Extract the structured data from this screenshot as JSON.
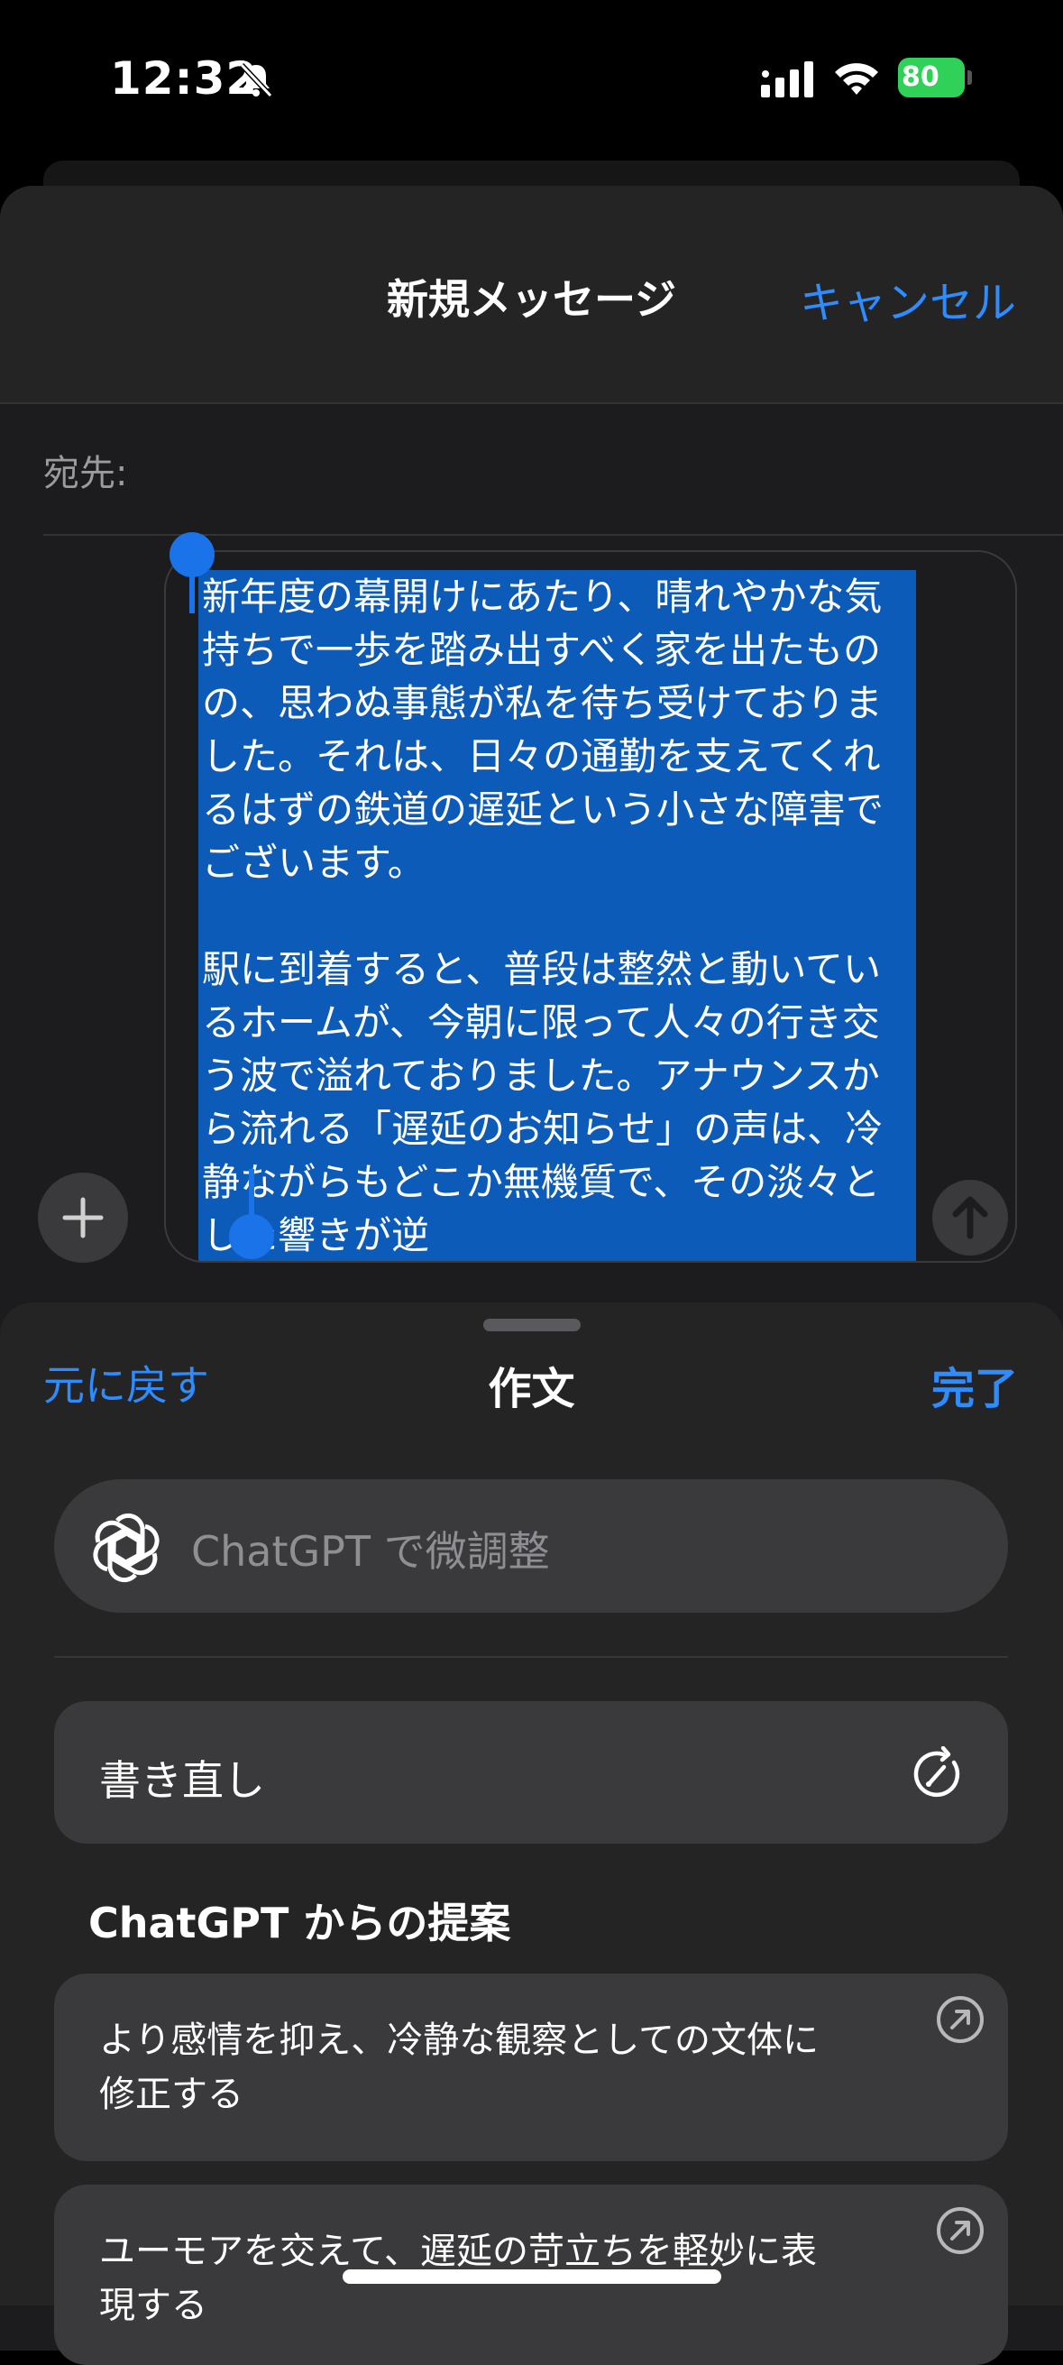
{
  "status_bar": {
    "time": "12:32",
    "battery": "80"
  },
  "header": {
    "title": "新規メッセージ",
    "cancel_label": "キャンセル"
  },
  "recipient": {
    "label": "宛先:"
  },
  "compose": {
    "text": "新年度の幕開けにあたり、晴れやかな気持ちで一歩を踏み出すべく家を出たものの、思わぬ事態が私を待ち受けておりました。それは、日々の通勤を支えてくれるはずの鉄道の遅延という小さな障害でございます。\n\n駅に到着すると、普段は整然と動いているホームが、今朝に限って人々の行き交う波で溢れておりました。アナウンスから流れる「遅延のお知らせ」の声は、冷静ながらもどこか無機質で、その淡々とした響きが逆"
  },
  "writing_tools": {
    "undo_label": "元に戻す",
    "title": "作文",
    "done_label": "完了",
    "chatgpt_placeholder": "ChatGPT で微調整",
    "rewrite_label": "書き直し",
    "suggestions_heading": "ChatGPT からの提案",
    "suggestions": [
      {
        "text": "より感情を抑え、冷静な観察としての文体に修正する"
      },
      {
        "text": "ユーモアを交えて、遅延の苛立ちを軽妙に表現する"
      }
    ]
  },
  "colors": {
    "accent": "#2f8cff",
    "selection": "#0c5bb8",
    "battery": "#30d158"
  }
}
